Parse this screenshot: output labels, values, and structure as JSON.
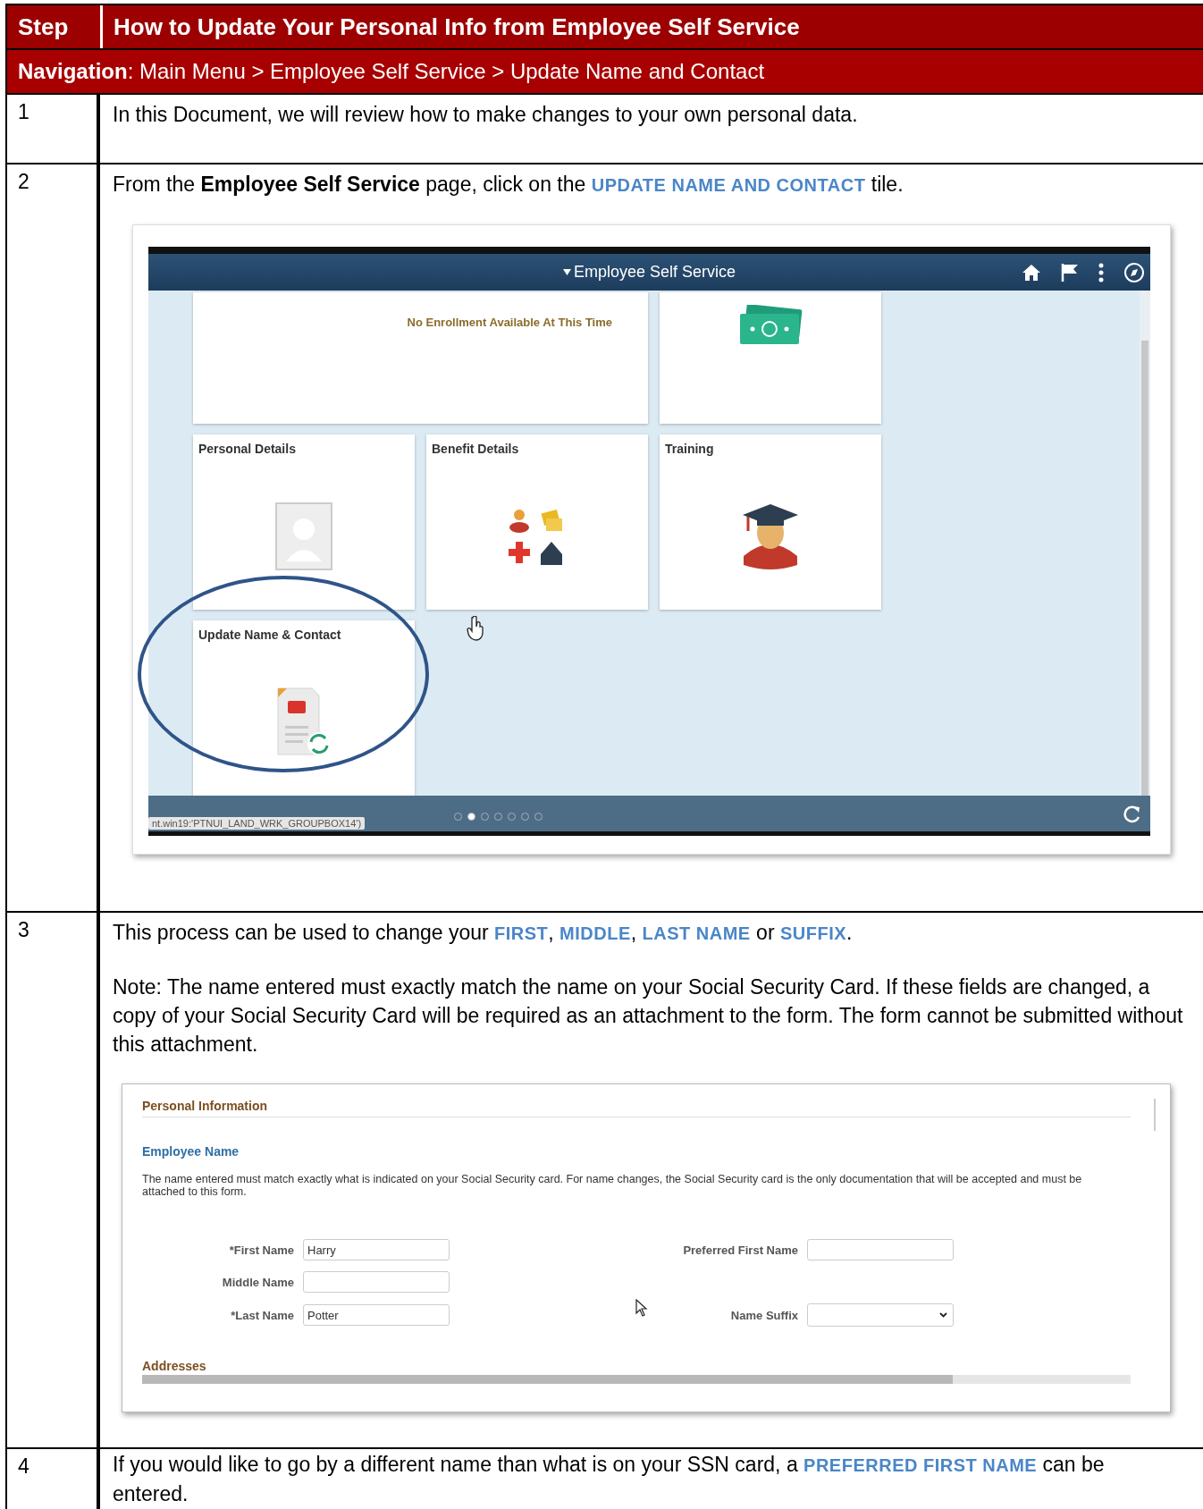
{
  "header": {
    "step": "Step",
    "title": "How to Update Your Personal Info from Employee Self Service"
  },
  "navigation": "**Navigation**: Main Menu > Employee Self Service > Update Name and Contact",
  "steps": [
    {
      "number": "1",
      "paragraphs": [
        [
          {
            "kind": "text",
            "text": "In this Document, we will review how to make changes to your own personal data."
          }
        ]
      ]
    },
    {
      "number": "2",
      "paragraphs": [
        [
          {
            "kind": "text",
            "text": "From the "
          },
          {
            "kind": "bold",
            "text": "Employee Self Service"
          },
          {
            "kind": "text",
            "text": " page, click on the "
          },
          {
            "kind": "term",
            "text": "UPDATE NAME AND CONTACT"
          },
          {
            "kind": "text",
            "text": " tile."
          }
        ]
      ],
      "figure": {
        "kind": "ess_home",
        "title": "Employee Self Service",
        "tiles": [
          {
            "kind": "enrollment",
            "text": "No Enrollment Available At This Time",
            "circled": false
          },
          {
            "kind": "pay",
            "circled": false
          },
          {
            "kind": "personal",
            "title": "Personal Details",
            "circled": false
          },
          {
            "kind": "benefits",
            "title": "Benefit Details",
            "circled": false
          },
          {
            "kind": "training",
            "title": "Training",
            "circled": false
          },
          {
            "kind": "update",
            "title": "Update Name & Contact",
            "circled": true
          }
        ],
        "status_text": "nt.win19:'PTNUI_LAND_WRK_GROUPBOX14')",
        "page_dots": [
          {
            "selected": false
          },
          {
            "selected": true
          },
          {
            "selected": false
          },
          {
            "selected": false
          },
          {
            "selected": false
          },
          {
            "selected": false
          },
          {
            "selected": false
          }
        ]
      }
    },
    {
      "number": "3",
      "paragraphs": [
        [
          {
            "kind": "text",
            "text": "This process can be used to change your "
          },
          {
            "kind": "term",
            "text": "FIRST"
          },
          {
            "kind": "text",
            "text": ", "
          },
          {
            "kind": "term",
            "text": "MIDDLE"
          },
          {
            "kind": "text",
            "text": ", "
          },
          {
            "kind": "term",
            "text": "LAST NAME"
          },
          {
            "kind": "text",
            "text": " or "
          },
          {
            "kind": "term",
            "text": "SUFFIX"
          },
          {
            "kind": "text",
            "text": "."
          }
        ],
        [
          {
            "kind": "text",
            "text": "Note: The name entered must exactly match the name on your Social Security Card.  If these fields are changed, a copy of your Social Security Card will be required as an attachment to the form. The form cannot be submitted without this attachment."
          }
        ]
      ],
      "figure": {
        "kind": "form",
        "section": "Personal Information",
        "subsection": "Employee Name",
        "note": "The name entered must match exactly what is indicated on your Social Security card.  For name changes, the Social Security card is the only documentation that will be accepted and must be attached to this form.",
        "rows": [
          {
            "left": {
              "label": "*First Name",
              "kind": "text",
              "value": "Harry"
            },
            "right": {
              "label": "Preferred First Name",
              "kind": "text"
            }
          },
          {
            "left": {
              "label": "Middle Name",
              "kind": "text"
            }
          },
          {
            "left": {
              "label": "*Last Name",
              "kind": "text",
              "value": "Potter"
            },
            "right": {
              "label": "Name Suffix",
              "kind": "select"
            }
          }
        ],
        "next_section": "Addresses"
      }
    },
    {
      "number": "4",
      "paragraphs": [
        [
          {
            "kind": "text",
            "text": "If you would like to go by a different name than what is on your SSN card, a "
          },
          {
            "kind": "term",
            "text": "PREFERRED FIRST NAME"
          },
          {
            "kind": "text",
            "text": " can be entered."
          }
        ]
      ]
    }
  ]
}
